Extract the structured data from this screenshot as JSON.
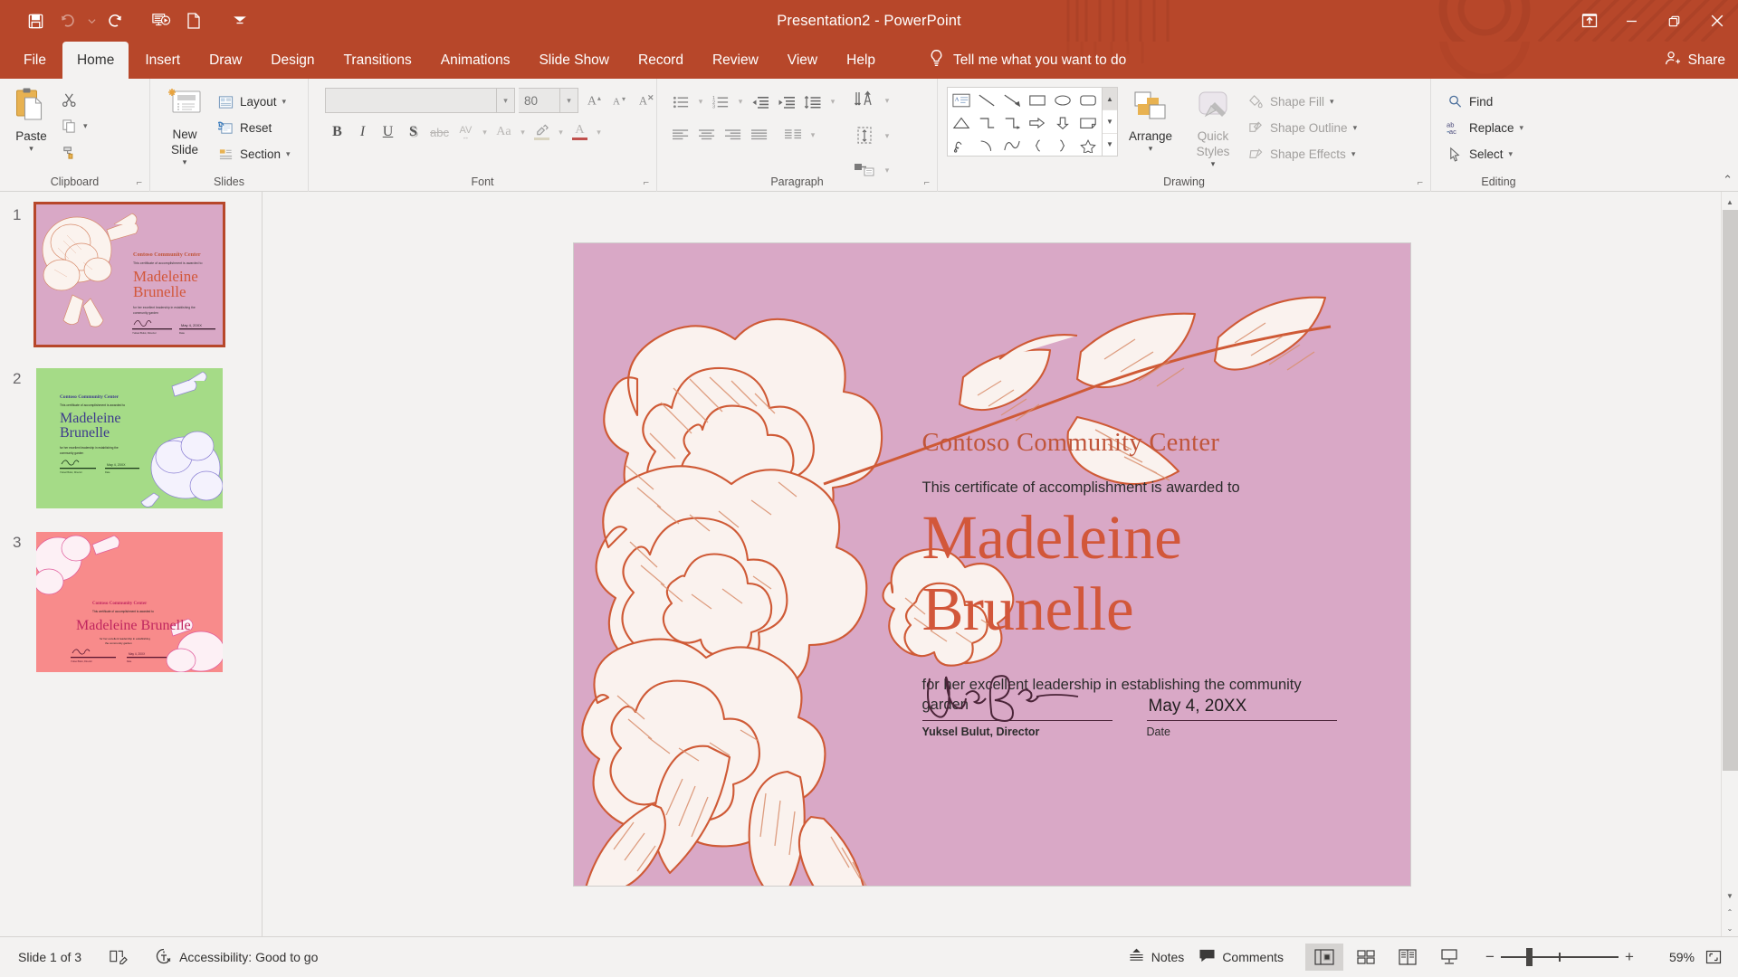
{
  "window": {
    "title": "Presentation2",
    "separator": "-",
    "app": "PowerPoint",
    "quick_access": [
      {
        "name": "save-icon",
        "label": "Save"
      },
      {
        "name": "undo-icon",
        "label": "Undo"
      },
      {
        "name": "undo-dropdown-icon",
        "label": "Undo options"
      },
      {
        "name": "redo-icon",
        "label": "Redo"
      },
      {
        "name": "start-presentation-icon",
        "label": "Start From Beginning"
      },
      {
        "name": "new-slide-quick-icon",
        "label": "New Slide"
      },
      {
        "name": "customize-qat-icon",
        "label": "Customize Quick Access Toolbar"
      }
    ],
    "controls": {
      "ribbon_display": "Ribbon Display Options",
      "minimize": "Minimize",
      "restore": "Restore Down",
      "close": "Close"
    }
  },
  "ribbon": {
    "tabs": [
      {
        "label": "File",
        "active": false
      },
      {
        "label": "Home",
        "active": true
      },
      {
        "label": "Insert",
        "active": false
      },
      {
        "label": "Draw",
        "active": false
      },
      {
        "label": "Design",
        "active": false
      },
      {
        "label": "Transitions",
        "active": false
      },
      {
        "label": "Animations",
        "active": false
      },
      {
        "label": "Slide Show",
        "active": false
      },
      {
        "label": "Record",
        "active": false
      },
      {
        "label": "Review",
        "active": false
      },
      {
        "label": "View",
        "active": false
      },
      {
        "label": "Help",
        "active": false
      }
    ],
    "tell_me": "Tell me what you want to do",
    "share": "Share",
    "groups": {
      "clipboard": {
        "label": "Clipboard",
        "paste": "Paste",
        "cut": "Cut",
        "copy": "Copy",
        "format_painter": "Format Painter"
      },
      "slides": {
        "label": "Slides",
        "new_slide_line1": "New",
        "new_slide_line2": "Slide",
        "layout": "Layout",
        "reset": "Reset",
        "section": "Section"
      },
      "font": {
        "label": "Font",
        "font_name_value": "",
        "font_size_value": "80",
        "bold": "B",
        "italic": "I",
        "underline": "U",
        "shadow": "S",
        "strikethrough": "abc",
        "character_spacing": "AV",
        "change_case": "Aa",
        "text_highlight": "A",
        "font_color": "A",
        "clear_formatting": "Clear All Formatting"
      },
      "paragraph": {
        "label": "Paragraph",
        "bullets": "Bullets",
        "numbering": "Numbering",
        "decrease_indent": "Decrease List Level",
        "increase_indent": "Increase List Level",
        "line_spacing": "Line Spacing",
        "text_direction": "Text Direction",
        "align_text": "Align Text",
        "convert_smartart": "Convert to SmartArt",
        "align_left": "Align Left",
        "center": "Center",
        "align_right": "Align Right",
        "justify": "Justify",
        "columns": "Columns"
      },
      "drawing": {
        "label": "Drawing",
        "arrange": "Arrange",
        "quick_styles_line1": "Quick",
        "quick_styles_line2": "Styles",
        "shape_fill": "Shape Fill",
        "shape_outline": "Shape Outline",
        "shape_effects": "Shape Effects",
        "shapes_gallery": "Shapes"
      },
      "editing": {
        "label": "Editing",
        "find": "Find",
        "replace": "Replace",
        "select": "Select"
      }
    }
  },
  "thumbnails": [
    {
      "number": "1",
      "selected": true,
      "theme": "pink",
      "title": "Contoso Community Center",
      "name": "Madeleine Brunelle"
    },
    {
      "number": "2",
      "selected": false,
      "theme": "green",
      "title": "Contoso Community Center",
      "name": "Madeleine Brunelle"
    },
    {
      "number": "3",
      "selected": false,
      "theme": "coral",
      "title": "Contoso Community Center",
      "name": "Madeleine Brunelle"
    }
  ],
  "slide": {
    "background_color": "#d9a8c6",
    "accent_color": "#c85a3c",
    "organization": "Contoso Community Center",
    "subtitle": "This certificate of accomplishment is awarded to",
    "recipient_line1": "Madeleine",
    "recipient_line2": "Brunelle",
    "reason": "for her excellent leadership in establishing the community garden",
    "signature_caption": "Yuksel Bulut, Director",
    "date_value": "May 4, 20XX",
    "date_caption": "Date"
  },
  "status_bar": {
    "slide_count": "Slide 1 of 3",
    "notes_icon_label": "Notes pane",
    "accessibility": "Accessibility: Good to go",
    "notes": "Notes",
    "comments": "Comments",
    "views": [
      {
        "name": "normal-view",
        "label": "Normal",
        "active": true
      },
      {
        "name": "slide-sorter-view",
        "label": "Slide Sorter",
        "active": false
      },
      {
        "name": "reading-view",
        "label": "Reading View",
        "active": false
      },
      {
        "name": "slide-show-view",
        "label": "Slide Show",
        "active": false
      }
    ],
    "zoom_out": "−",
    "zoom_in": "+",
    "zoom_value": "59%",
    "fit_to_window": "Fit slide to current window"
  }
}
